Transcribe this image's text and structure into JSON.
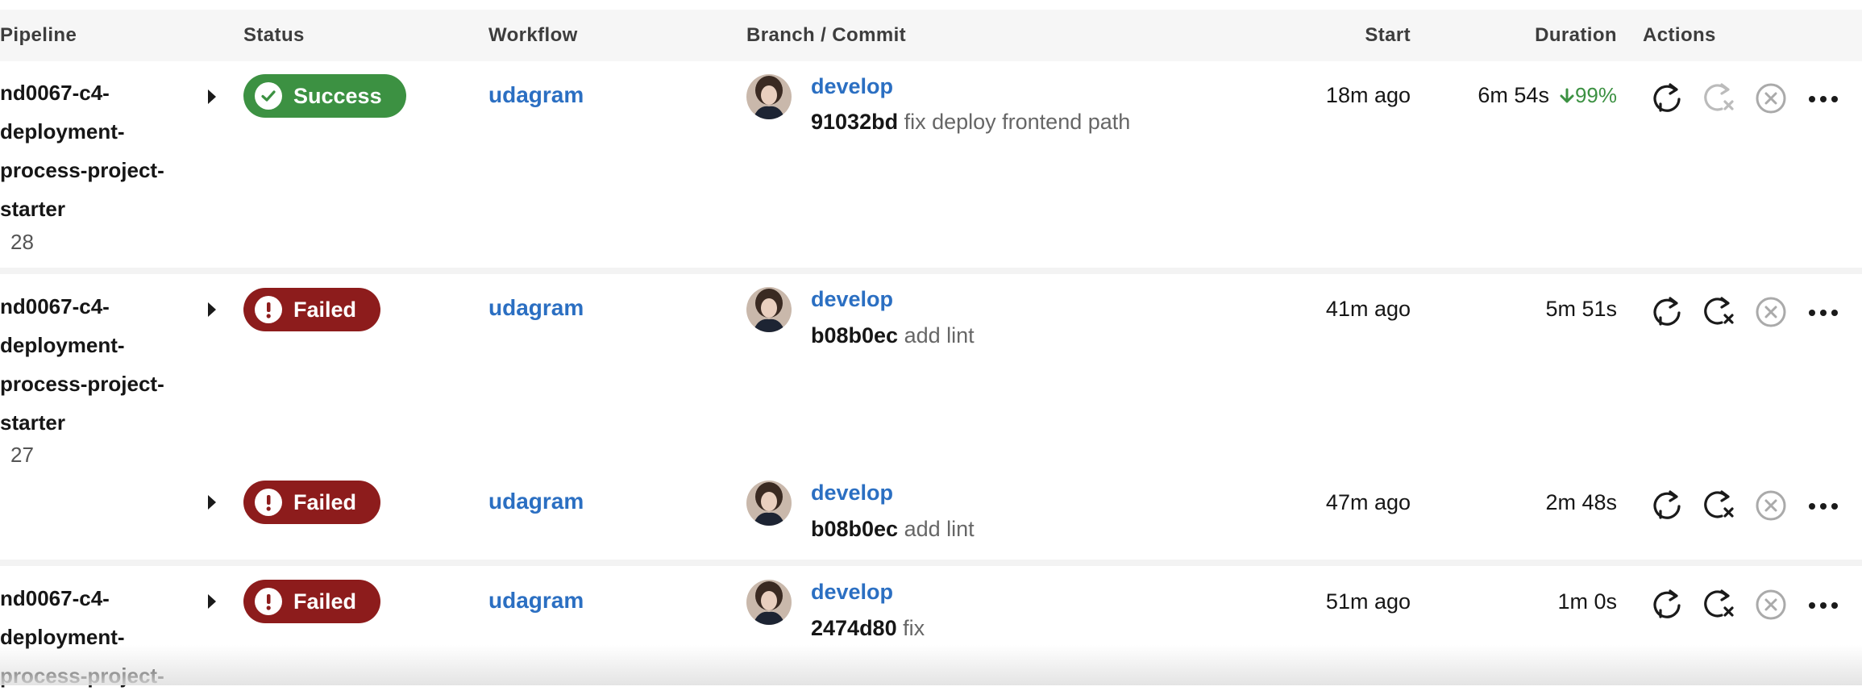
{
  "columns": {
    "pipeline": "Pipeline",
    "status": "Status",
    "workflow": "Workflow",
    "branch_commit": "Branch / Commit",
    "start": "Start",
    "duration": "Duration",
    "actions": "Actions"
  },
  "colors": {
    "success": "#3c9142",
    "failed": "#8d1c1c",
    "link": "#2b6fc2"
  },
  "rows": [
    {
      "pipeline_lines": [
        "nd0067-c4-",
        "deployment-",
        "process-project-",
        "starter"
      ],
      "number": "28",
      "status": "Success",
      "workflow": "udagram",
      "branch": "develop",
      "hash": "91032bd",
      "message": "fix deploy frontend path",
      "start": "18m ago",
      "duration": "6m 54s",
      "trend": "99%"
    },
    {
      "pipeline_lines": [
        "nd0067-c4-",
        "deployment-",
        "process-project-",
        "starter"
      ],
      "number": "27",
      "status": "Failed",
      "workflow": "udagram",
      "branch": "develop",
      "hash": "b08b0ec",
      "message": "add lint",
      "start": "41m ago",
      "duration": "5m 51s"
    },
    {
      "status": "Failed",
      "workflow": "udagram",
      "branch": "develop",
      "hash": "b08b0ec",
      "message": "add lint",
      "start": "47m ago",
      "duration": "2m 48s"
    },
    {
      "pipeline_lines": [
        "nd0067-c4-",
        "deployment-",
        "process-project-"
      ],
      "status": "Failed",
      "workflow": "udagram",
      "branch": "develop",
      "hash": "2474d80",
      "message": "fix",
      "start": "51m ago",
      "duration": "1m 0s"
    }
  ],
  "icons": {
    "success": "check-circle-icon",
    "failed": "exclamation-circle-icon",
    "expand": "caret-right-icon",
    "rerun": "rerun-icon",
    "rerun_failed": "rerun-failed-icon",
    "cancel": "cancel-icon",
    "more": "more-icon",
    "trend": "arrow-down-icon"
  }
}
